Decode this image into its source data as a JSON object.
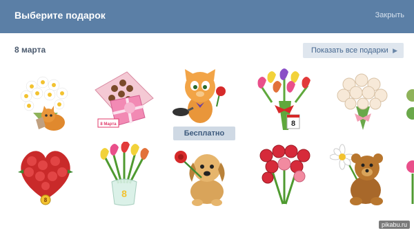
{
  "header": {
    "title": "Выберите подарок",
    "close_label": "Закрыть"
  },
  "section": {
    "title": "8 марта",
    "show_all_label": "Показать все подарки",
    "show_all_chevron": "▶"
  },
  "gifts": [
    {
      "icon": "daisy-bouquet-cat-icon"
    },
    {
      "icon": "chocolate-box-icon",
      "inscription": "8 Марта"
    },
    {
      "icon": "cat-with-frying-pan-icon",
      "badge": "Бесплатно"
    },
    {
      "icon": "tulip-bouquet-icon",
      "inscription": "8"
    },
    {
      "icon": "white-roses-bouquet-icon"
    },
    {
      "icon": "heart-roses-icon",
      "inscription": "8"
    },
    {
      "icon": "tulips-in-vase-icon",
      "inscription": "8"
    },
    {
      "icon": "puppy-with-rose-icon"
    },
    {
      "icon": "red-roses-bouquet-icon"
    },
    {
      "icon": "teddy-bear-daisy-icon"
    }
  ],
  "watermark": "pikabu.ru",
  "colors": {
    "header_bg": "#5b7fa6",
    "button_bg": "#dfe6ee",
    "link": "#45678f"
  }
}
